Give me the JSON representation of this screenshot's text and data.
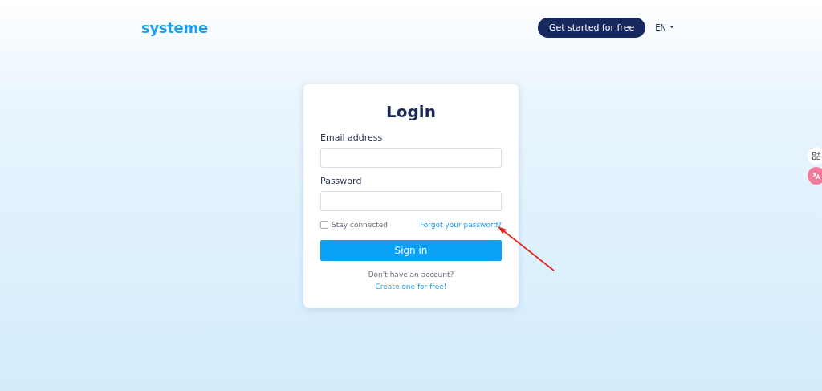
{
  "header": {
    "logo": "systeme",
    "cta": "Get started for free",
    "language": "EN"
  },
  "login": {
    "title": "Login",
    "fields": [
      {
        "label": "Email address"
      },
      {
        "label": "Password"
      }
    ],
    "remember": {
      "label": "Stay connected",
      "checked": false
    },
    "forgot": "Forgot your password?",
    "submit": "Sign in",
    "prompt": "Don't have an account?",
    "signup": "Create one for free!"
  }
}
